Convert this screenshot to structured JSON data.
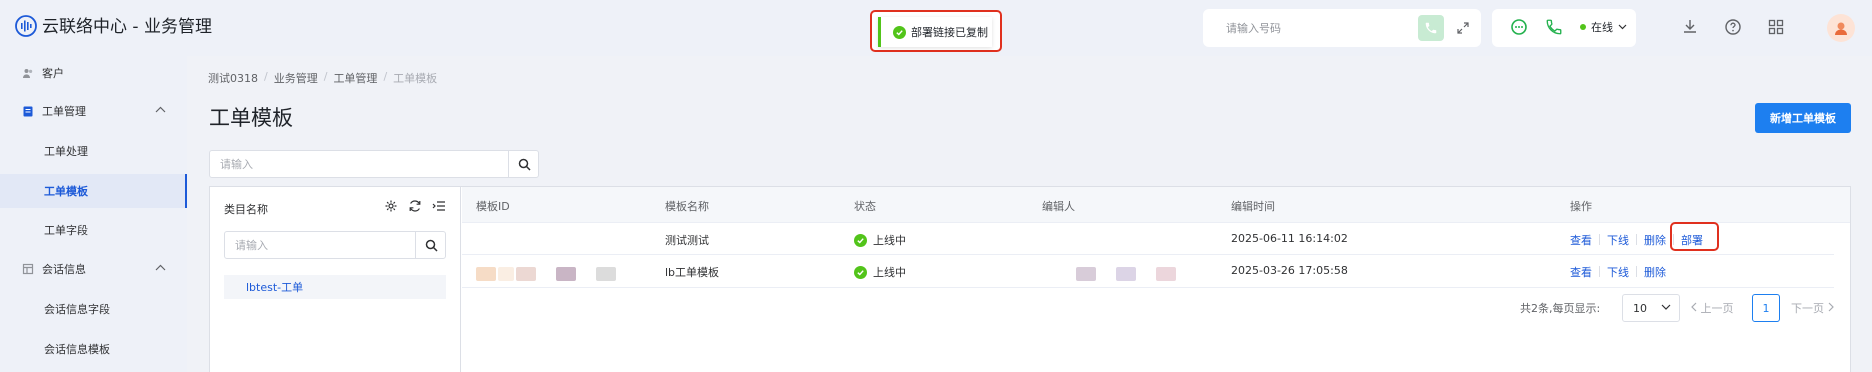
{
  "header": {
    "app_title": "云联络中心 - 业务管理",
    "toast": "部署链接已复制",
    "phone_placeholder": "请输入号码",
    "status": "在线"
  },
  "sidebar": {
    "items": [
      {
        "label": "客户",
        "icon": "users-icon"
      },
      {
        "label": "工单管理",
        "icon": "clipboard-icon"
      },
      {
        "label": "工单处理"
      },
      {
        "label": "工单模板"
      },
      {
        "label": "工单字段"
      },
      {
        "label": "会话信息",
        "icon": "table-icon"
      },
      {
        "label": "会话信息字段"
      },
      {
        "label": "会话信息模板"
      }
    ],
    "active_index": 3
  },
  "breadcrumb": [
    "测试0318",
    "业务管理",
    "工单管理",
    "工单模板"
  ],
  "page": {
    "title": "工单模板",
    "add_button": "新增工单模板",
    "search_placeholder": "请输入"
  },
  "category": {
    "title": "类目名称",
    "search_placeholder": "请输入",
    "node": "lbtest-工单"
  },
  "table": {
    "headers": [
      "模板ID",
      "模板名称",
      "状态",
      "编辑人",
      "编辑时间",
      "操作"
    ],
    "rows": [
      {
        "name": "测试测试",
        "status": "上线中",
        "time": "2025-06-11 16:14:02",
        "ops": [
          "查看",
          "下线",
          "删除",
          "部署"
        ]
      },
      {
        "name": "lb工单模板",
        "status": "上线中",
        "time": "2025-03-26 17:05:58",
        "ops": [
          "查看",
          "下线",
          "删除"
        ]
      }
    ]
  },
  "pagination": {
    "total": "共2条,每页显示:",
    "page_size": "10",
    "prev": "上一页",
    "current": "1",
    "next": "下一页"
  },
  "colors": {
    "primary": "#1d7ff0",
    "link": "#1d5ad8",
    "success": "#52c41a",
    "highlight": "#e0301e"
  }
}
